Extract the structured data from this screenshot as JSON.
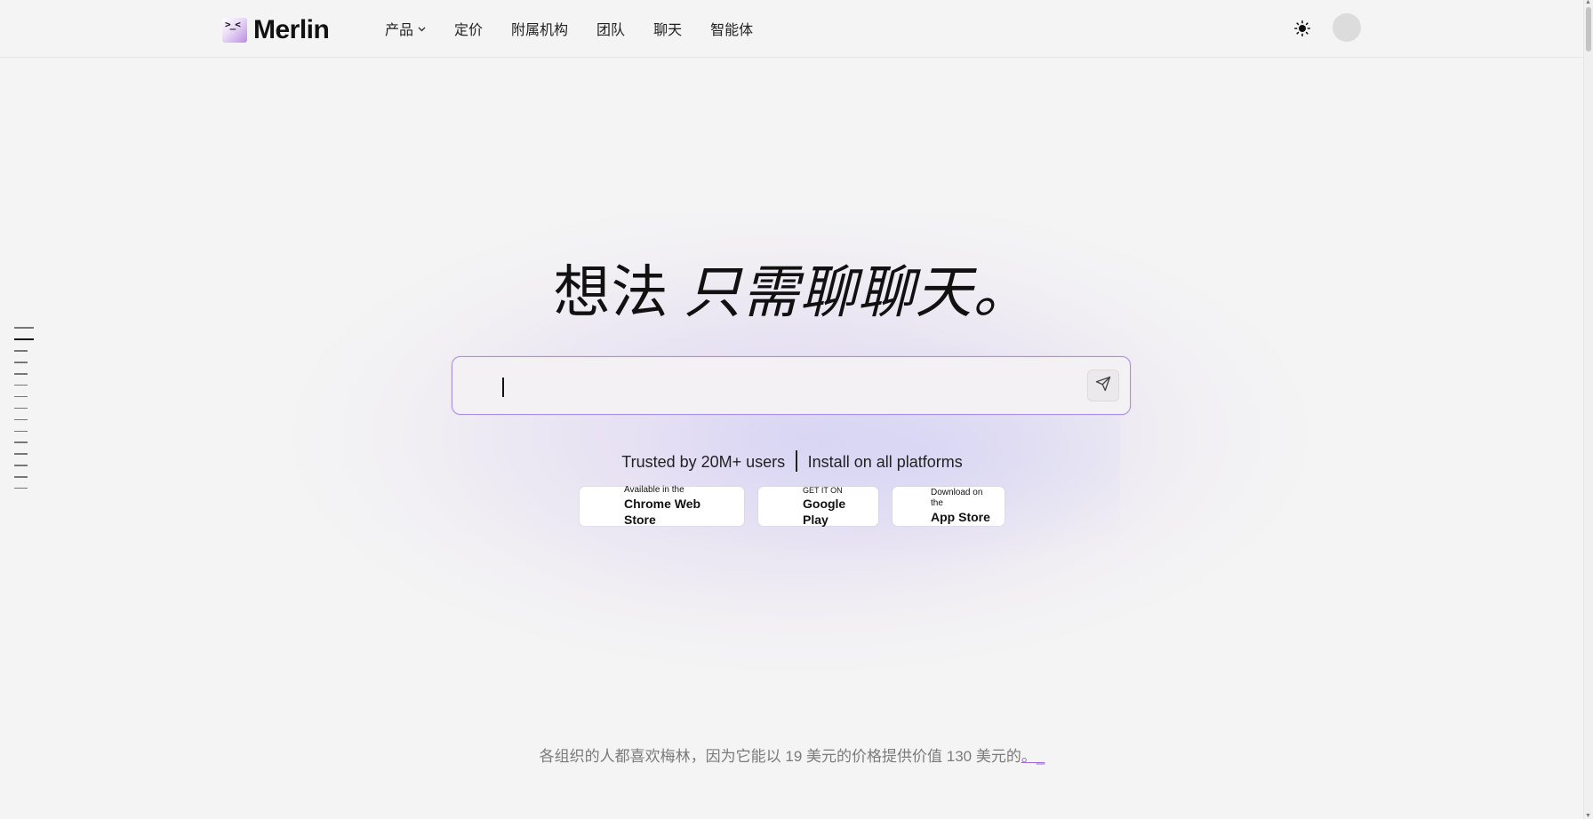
{
  "brand": {
    "name": "Merlin",
    "logo_face": ">_<"
  },
  "nav": {
    "items": [
      {
        "label": "产品",
        "has_dropdown": true
      },
      {
        "label": "定价"
      },
      {
        "label": "附属机构"
      },
      {
        "label": "团队"
      },
      {
        "label": "聊天"
      },
      {
        "label": "智能体"
      }
    ]
  },
  "hero": {
    "heading_regular": "想法",
    "heading_italic": " 只需聊聊天。"
  },
  "prompt": {
    "value": "",
    "placeholder": ""
  },
  "trust": {
    "left": "Trusted by 20M+ users",
    "right": "Install on all platforms"
  },
  "stores": {
    "chrome": {
      "small": "Available in the",
      "big": "Chrome Web Store"
    },
    "gplay": {
      "small": "GET IT ON",
      "big": "Google Play"
    },
    "apple": {
      "small": "Download on the",
      "big": "App Store"
    }
  },
  "footer": {
    "note": "各组织的人都喜欢梅林，因为它能以 19 美元的价格提供价值 130 美元的",
    "link": "。_"
  },
  "colors": {
    "accent": "#a98ee6",
    "background": "#f4f4f4",
    "link": "#9b6cd6"
  }
}
